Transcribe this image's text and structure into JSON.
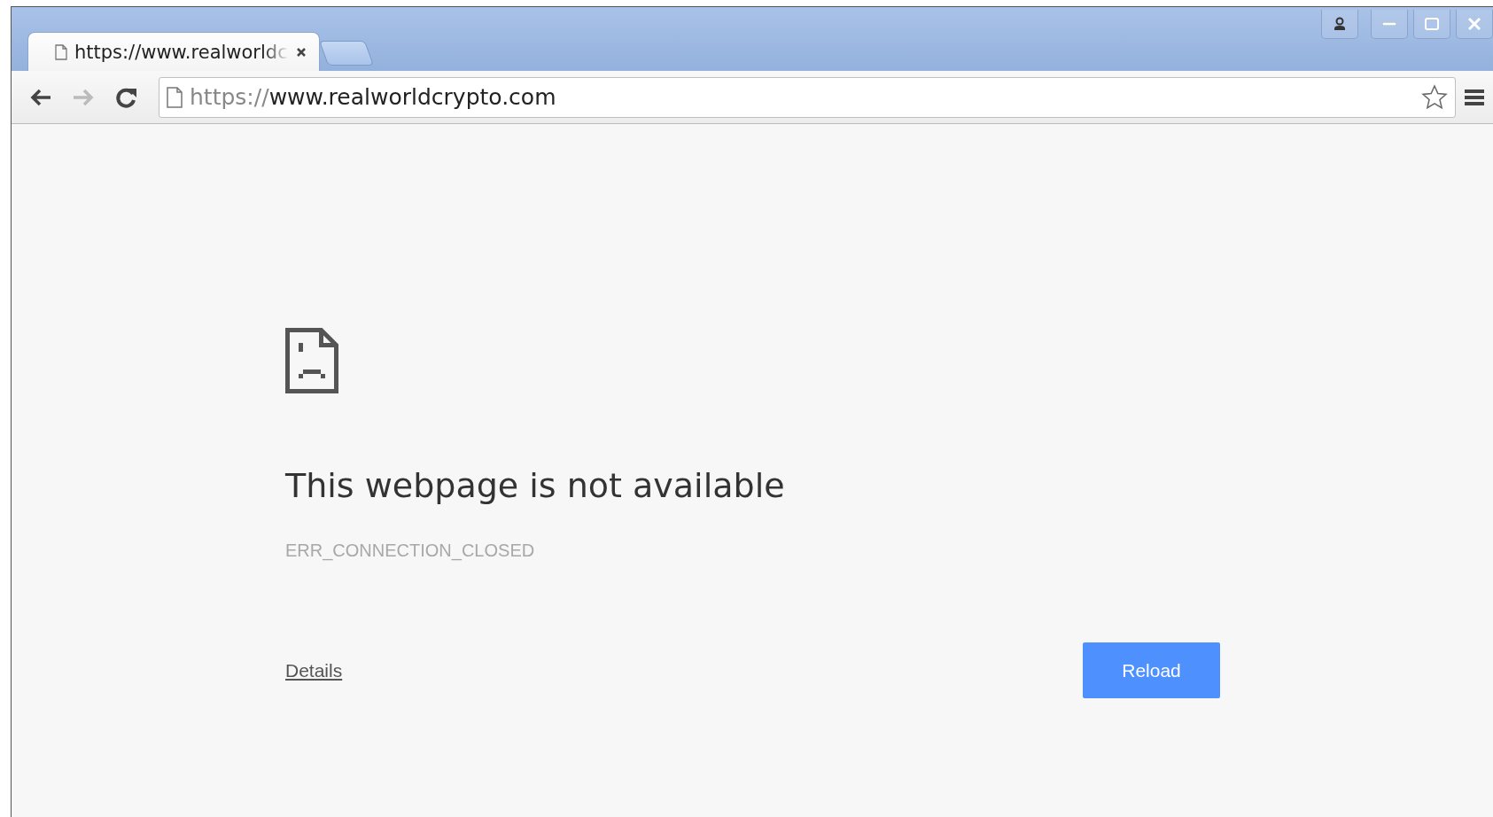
{
  "tabs": [
    {
      "title": "https://www.realworldc",
      "selected": true
    }
  ],
  "toolbar": {
    "back_enabled": true,
    "forward_enabled": false,
    "url_scheme": "https://",
    "url_rest": "www.realworldcrypto.com",
    "bookmarked": false
  },
  "error": {
    "title": "This webpage is not available",
    "code": "ERR_CONNECTION_CLOSED",
    "details_link": "Details",
    "reload_button": "Reload"
  }
}
